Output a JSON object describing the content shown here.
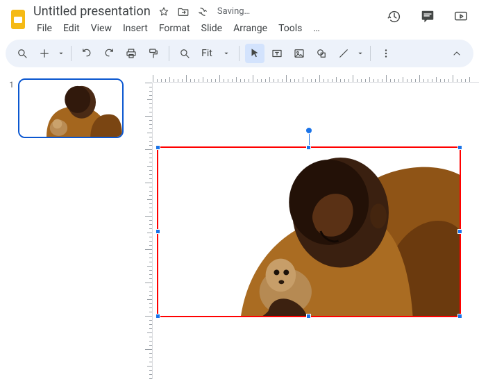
{
  "header": {
    "title": "Untitled presentation",
    "saving_label": "Saving…"
  },
  "menus": {
    "file": "File",
    "edit": "Edit",
    "view": "View",
    "insert": "Insert",
    "format": "Format",
    "slide": "Slide",
    "arrange": "Arrange",
    "tools": "Tools",
    "ext": "…"
  },
  "toolbar": {
    "zoom_label": "Fit"
  },
  "thumbnails": {
    "items": [
      {
        "index": "1"
      }
    ]
  },
  "icons": {
    "star": "star-icon",
    "move": "move-to-icon",
    "cloud": "cloud-sync-icon",
    "history": "version-history-icon",
    "comments": "comments-icon",
    "present": "present-icon",
    "search": "search-icon",
    "plus": "new-slide-icon",
    "undo": "undo-icon",
    "redo": "redo-icon",
    "print": "print-icon",
    "paint": "paint-format-icon",
    "zoom": "zoom-icon",
    "zoom_drop": "zoom-dropdown",
    "cursor": "select-tool",
    "textbox": "textbox-tool",
    "image": "insert-image",
    "shape": "insert-shape",
    "line": "insert-line",
    "more": "more-tools",
    "collapse": "collapse-toolbar"
  }
}
